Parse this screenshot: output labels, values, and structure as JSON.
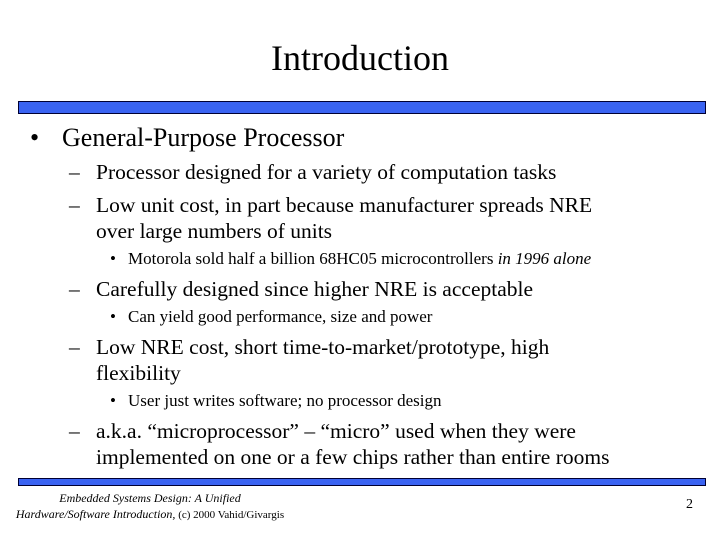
{
  "slide": {
    "title": "Introduction",
    "page_number": "2",
    "accent_color": "#3a63f2",
    "bar_border_color": "#000033"
  },
  "bullets": {
    "b1": {
      "marker": "•",
      "text": "General-Purpose Processor"
    },
    "b1_1": {
      "marker": "–",
      "text": "Processor designed for a variety of computation tasks"
    },
    "b1_2": {
      "marker": "–",
      "line1": "Low unit cost, in part because manufacturer spreads NRE",
      "line2": "over large numbers of units"
    },
    "b1_2_1": {
      "marker": "•",
      "text": "Motorola sold half a billion 68HC05 microcontrollers ",
      "italic": "in 1996 alone"
    },
    "b1_3": {
      "marker": "–",
      "text": "Carefully designed since higher NRE is acceptable"
    },
    "b1_3_1": {
      "marker": "•",
      "text": "Can yield good performance, size and power"
    },
    "b1_4": {
      "marker": "–",
      "line1": "Low NRE cost, short time-to-market/prototype, high",
      "line2": "flexibility"
    },
    "b1_4_1": {
      "marker": "•",
      "text": "User just writes software; no processor design"
    },
    "b1_5": {
      "marker": "–",
      "line1": "a.k.a. “microprocessor” – “micro” used when they were",
      "line2": "implemented on one or a few chips rather than entire rooms"
    }
  },
  "footer": {
    "line1": "Embedded Systems Design: A Unified",
    "line2_italic": "Hardware/Software Introduction,",
    "line2_plain": " (c) 2000 Vahid/Givargis"
  }
}
